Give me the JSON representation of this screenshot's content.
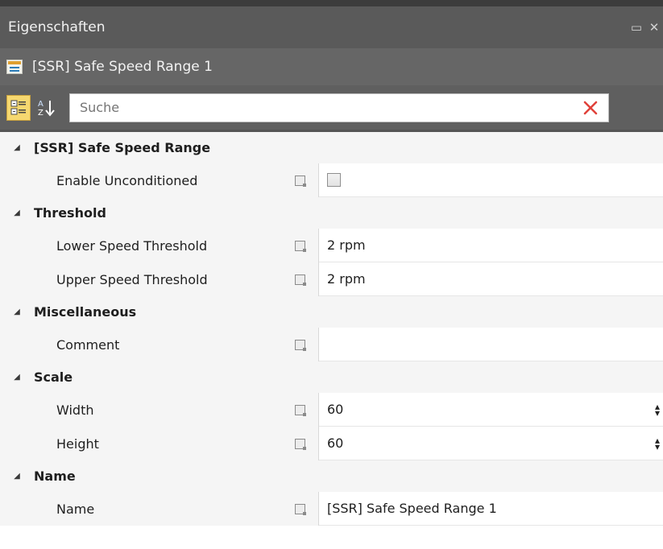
{
  "panel": {
    "title": "Eigenschaften",
    "restore_glyph": "▭",
    "close_glyph": "✕"
  },
  "object": {
    "name": "[SSR] Safe Speed Range 1"
  },
  "toolbar": {
    "search_placeholder": "Suche",
    "clear_icon": "red-x-icon"
  },
  "categories": [
    {
      "label": "[SSR] Safe Speed Range",
      "props": [
        {
          "name": "Enable Unconditioned",
          "value": ""
        }
      ]
    },
    {
      "label": "Threshold",
      "props": [
        {
          "name": "Lower Speed Threshold",
          "value": "2 rpm"
        },
        {
          "name": "Upper Speed Threshold",
          "value": "2 rpm"
        }
      ]
    },
    {
      "label": "Miscellaneous",
      "props": [
        {
          "name": "Comment",
          "value": ""
        }
      ]
    },
    {
      "label": "Scale",
      "props": [
        {
          "name": "Width",
          "value": "60"
        },
        {
          "name": "Height",
          "value": "60"
        }
      ]
    },
    {
      "label": "Name",
      "props": [
        {
          "name": "Name",
          "value": "[SSR] Safe Speed Range 1"
        }
      ]
    }
  ],
  "colors": {
    "titlebar": "#5a5a5a",
    "active_toggle": "#f6d870",
    "clear_x": "#e0413a"
  }
}
